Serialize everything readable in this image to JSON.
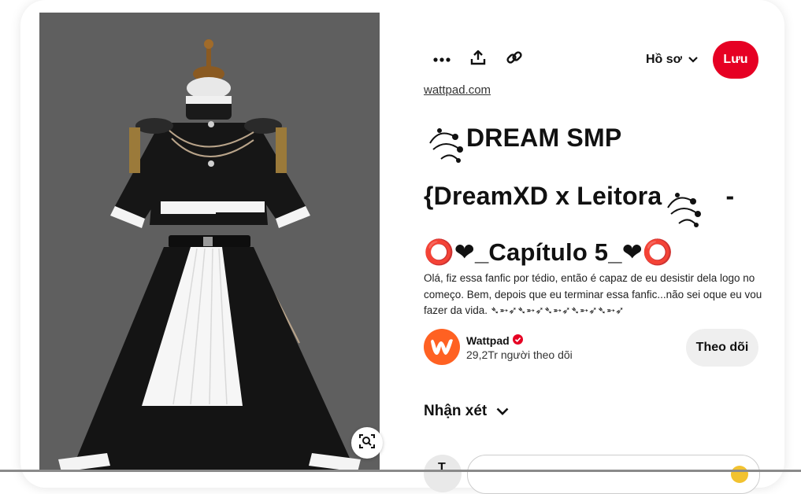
{
  "pin": {
    "source_domain": "wattpad.com",
    "title_lines": [
      "DREAM SMP",
      "{DreamXD x Leitora",
      "-",
      "⭕❤_Capítulo 5_❤⭕"
    ],
    "description": "Olá, fiz essa fanfic por tédio, então é capaz de eu desistir dela logo no começo. Bem, depois que eu terminar essa fanfic...não sei oque eu vou fazer da vida. ➴➵➶➴➵➶➴➵➶➴➵➶➴➵➶"
  },
  "toolbar": {
    "more_icon": "more-horizontal-icon",
    "share_icon": "share-upload-icon",
    "link_icon": "link-chain-icon",
    "board_label": "Hồ sơ",
    "save_label": "Lưu"
  },
  "creator": {
    "name": "Wattpad",
    "followers": "29,2Tr người theo dõi",
    "follow_label": "Theo dõi",
    "verified_icon": "verified-badge-icon"
  },
  "comments": {
    "header": "Nhận xét",
    "commenter_initial": "T"
  },
  "colors": {
    "accent": "#e60023",
    "wattpad_brand": "#ff6122",
    "image_background": "#5f5f5f"
  }
}
